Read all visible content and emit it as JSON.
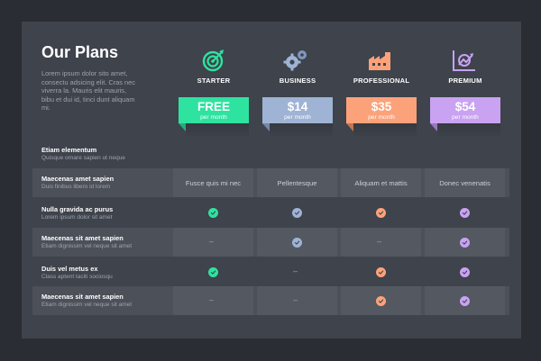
{
  "header": {
    "title": "Our Plans",
    "description": "Lorem ipsum dolor sito amet, consectu adsicing elit. Cras nec viverra la. Mauris elit mauris, bibu et dui id, tinci dunt aliquam mi."
  },
  "plans": [
    {
      "name": "STARTER",
      "price": "FREE",
      "per": "per month",
      "color": "#2ee3a0",
      "icon": "target-icon"
    },
    {
      "name": "BUSINESS",
      "price": "$14",
      "per": "per month",
      "color": "#9fb3d4",
      "icon": "gears-icon"
    },
    {
      "name": "PROFESSIONAL",
      "price": "$35",
      "per": "per month",
      "color": "#fca27a",
      "icon": "factory-icon"
    },
    {
      "name": "PREMIUM",
      "price": "$54",
      "per": "per month",
      "color": "#c9a2f2",
      "icon": "growth-chart-icon"
    }
  ],
  "rows": [
    {
      "label": "Etiam elementum",
      "sub": "Quisque ornare sapien ut neque"
    },
    {
      "label": "Maecenas amet sapien",
      "sub": "Duis finibus libero id lorem",
      "cells": [
        "Fusce quis mi nec",
        "Pellentesque",
        "Aliquam et mattis",
        "Donec venenatis"
      ]
    },
    {
      "label": "Nulla gravida ac purus",
      "sub": "Lorem ipsum dolor sit amet",
      "checks": [
        true,
        true,
        true,
        true
      ]
    },
    {
      "label": "Maecenas sit amet sapien",
      "sub": "Etiam dignissim vel neque sit amet",
      "checks": [
        false,
        true,
        false,
        true
      ],
      "dash": "–"
    },
    {
      "label": "Duis vel metus ex",
      "sub": "Class aptent taciti sociosqu",
      "checks": [
        true,
        false,
        true,
        true
      ],
      "dash": "–"
    },
    {
      "label": "Maecenas sit amet sapien",
      "sub": "Etiam dignissim vel neque sit amet",
      "checks": [
        false,
        false,
        true,
        true
      ],
      "dash": "–"
    }
  ]
}
